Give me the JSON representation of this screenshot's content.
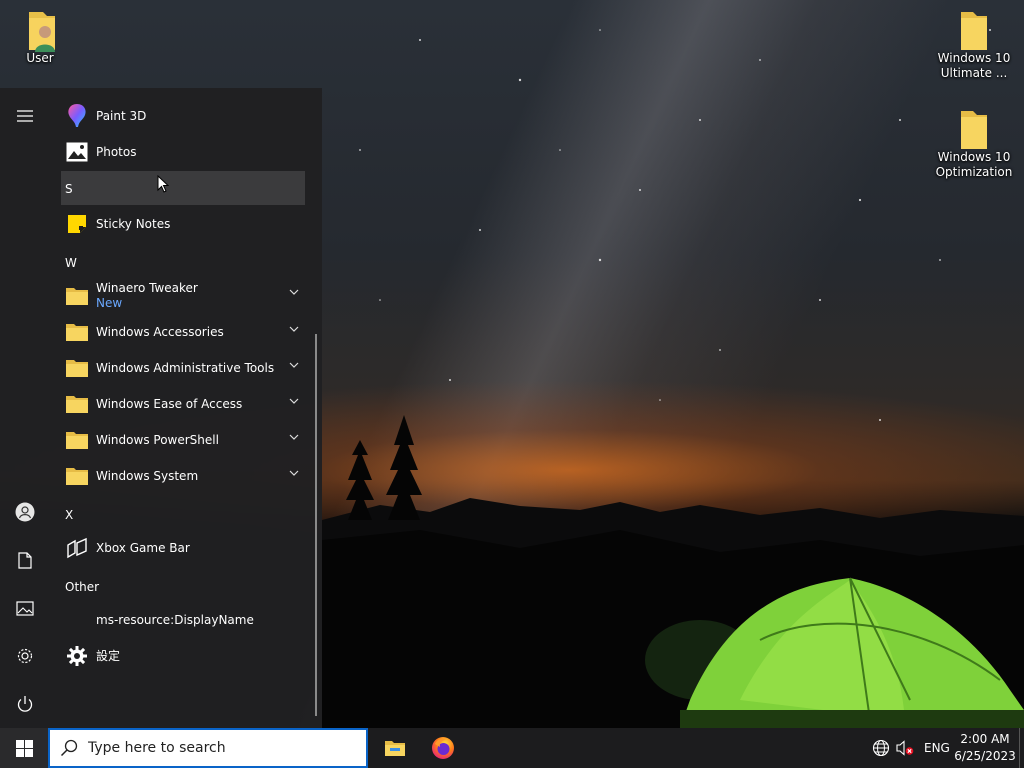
{
  "desktop": {
    "icons": [
      {
        "label": "User",
        "icon": "user-folder-icon"
      },
      {
        "label": "Windows 10 Ultimate ...",
        "icon": "folder-icon"
      },
      {
        "label": "Windows 10 Optimization",
        "icon": "folder-icon"
      }
    ]
  },
  "start_menu": {
    "rail": [
      "menu-icon",
      "user-icon",
      "documents-icon",
      "pictures-icon",
      "settings-icon",
      "power-icon"
    ],
    "apps": [
      {
        "label": "Paint 3D",
        "icon": "paint-3d-icon"
      },
      {
        "label": "Photos",
        "icon": "photos-icon"
      },
      {
        "letter": "S"
      },
      {
        "label": "Sticky Notes",
        "icon": "sticky-notes-icon"
      },
      {
        "letter": "W"
      },
      {
        "label": "Winaero Tweaker",
        "badge": "New",
        "icon": "folder-icon",
        "expandable": true
      },
      {
        "label": "Windows Accessories",
        "icon": "folder-icon",
        "expandable": true
      },
      {
        "label": "Windows Administrative Tools",
        "icon": "folder-icon",
        "expandable": true
      },
      {
        "label": "Windows Ease of Access",
        "icon": "folder-icon",
        "expandable": true
      },
      {
        "label": "Windows PowerShell",
        "icon": "folder-icon",
        "expandable": true
      },
      {
        "label": "Windows System",
        "icon": "folder-icon",
        "expandable": true
      },
      {
        "letter": "X"
      },
      {
        "label": "Xbox Game Bar",
        "icon": "xbox-game-bar-icon"
      },
      {
        "letter": "Other"
      },
      {
        "label": "ms-resource:DisplayName",
        "icon": ""
      },
      {
        "label": "設定",
        "icon": "settings-gear-icon"
      }
    ]
  },
  "taskbar": {
    "search_placeholder": "Type here to search",
    "pinned": [
      "file-explorer-icon",
      "firefox-icon"
    ],
    "tray": {
      "language": "ENG",
      "time": "2:00 AM",
      "date": "6/25/2023"
    }
  },
  "colors": {
    "accent": "#0a64c8",
    "folder": "#f5c542",
    "badge_new": "#6aa8ff"
  }
}
